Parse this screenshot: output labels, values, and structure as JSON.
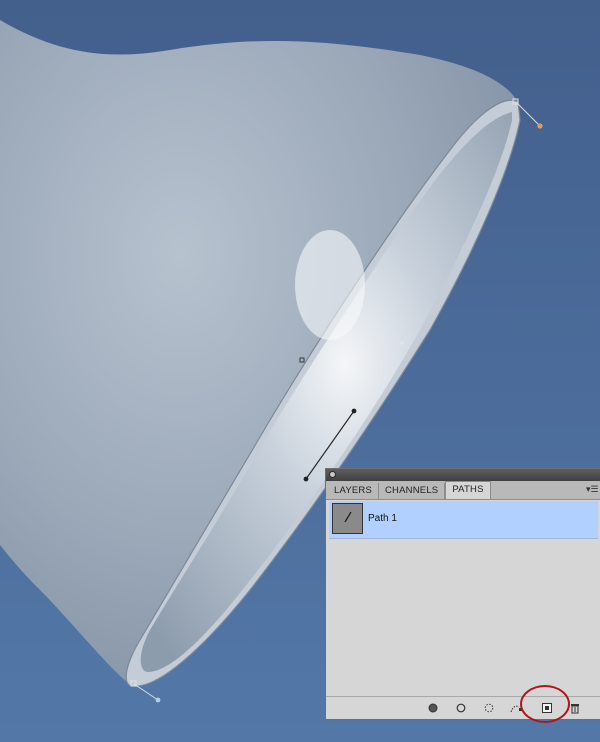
{
  "panel": {
    "tabs": [
      {
        "label": "LAYERS"
      },
      {
        "label": "CHANNELS"
      },
      {
        "label": "PATHS"
      }
    ],
    "paths": [
      {
        "name": "Path 1"
      }
    ],
    "footer_buttons": [
      {
        "icon": "fill-path-icon"
      },
      {
        "icon": "stroke-path-icon"
      },
      {
        "icon": "load-selection-icon"
      },
      {
        "icon": "make-work-path-icon"
      },
      {
        "icon": "new-path-icon"
      },
      {
        "icon": "trash-icon"
      }
    ]
  },
  "colors": {
    "background": "#4a6a98",
    "lamp": "#9aa8b8",
    "selected_row": "#b2d0ff",
    "annotation_ring": "#b1151a"
  }
}
